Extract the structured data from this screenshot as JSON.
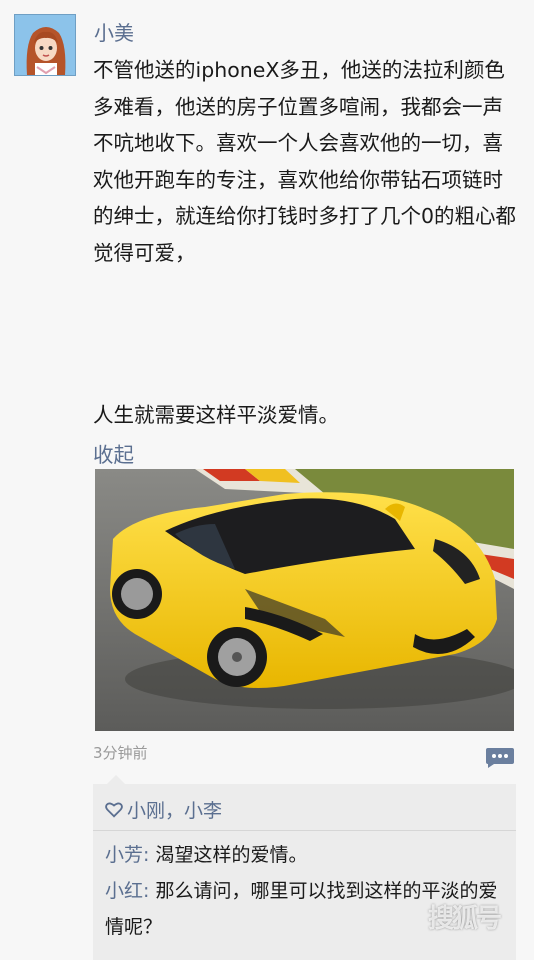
{
  "post": {
    "author": "小美",
    "text": "不管他送的iphoneX多丑，他送的法拉利颜色多难看，他送的房子位置多喧闹，我都会一声不吭地收下。喜欢一个人会喜欢他的一切，喜欢他开跑车的专注，喜欢他给你带钻石项链时的绅士，就连给你打钱时多打了几个0的粗心都觉得可爱，",
    "text2": "人生就需要这样平淡爱情。",
    "collapse_label": "收起",
    "time": "3分钟前"
  },
  "likes": {
    "names": "小刚，小李"
  },
  "comments": [
    {
      "author": "小芳:",
      "text": " 渴望这样的爱情。"
    },
    {
      "author": "小红:",
      "text": " 那么请问，哪里可以找到这样的平淡的爱情呢？"
    }
  ],
  "watermark": "搜狐号"
}
